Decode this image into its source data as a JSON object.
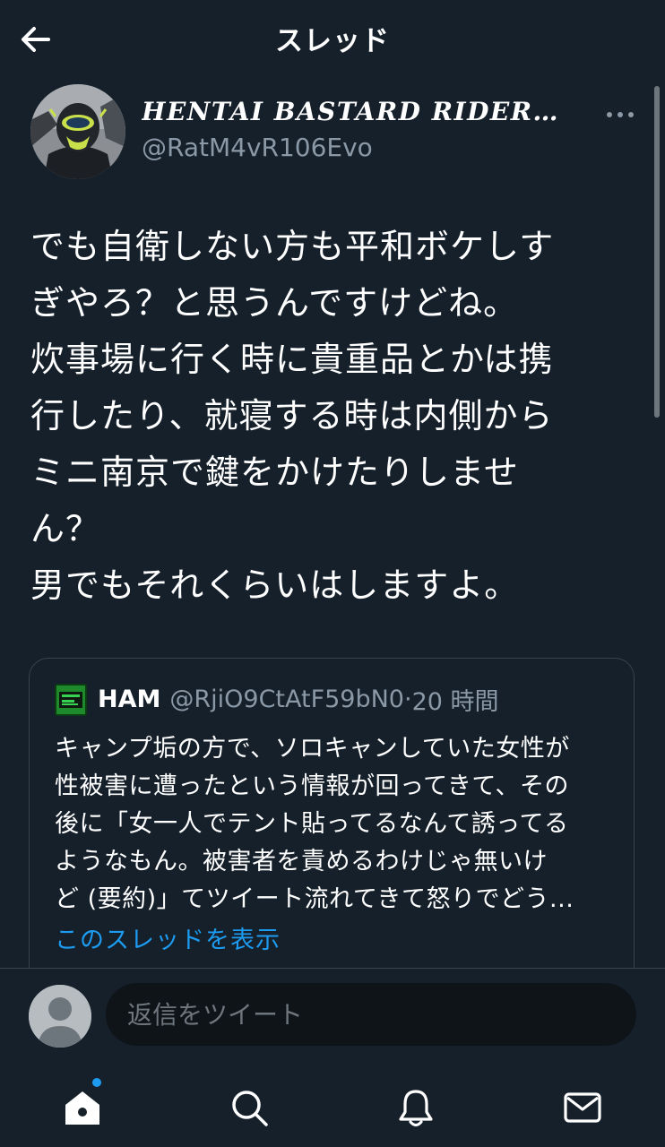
{
  "header": {
    "title": "スレッド"
  },
  "tweet": {
    "display_name": "HENTAI BASTARD RIDER©...",
    "handle": "@RatM4vR106Evo",
    "lines": [
      "でも自衛しない方も平和ボケしす",
      "ぎやろ？と思うんですけどね。",
      "炊事場に行く時に貴重品とかは携",
      "行したり、就寝する時は内側から",
      "ミニ南京で鍵をかけたりしませ",
      "ん？",
      "男でもそれくらいはしますよ。"
    ]
  },
  "quote": {
    "name": "HAM",
    "handle": "@RjiO9CtAtF59bN0",
    "separator": "·",
    "time": "20 時間",
    "lines": [
      "キャンプ垢の方で、ソロキャンしていた女性が",
      "性被害に遭ったという情報が回ってきて、その",
      "後に「女一人でテント貼ってるなんて誘ってる",
      "ようなもん。被害者を責めるわけじゃ無いけ",
      "ど (要約)」てツイート流れてきて怒りでどう..."
    ],
    "show_thread": "このスレッドを表示"
  },
  "reply": {
    "placeholder": "返信をツイート"
  },
  "colors": {
    "background": "#15202b",
    "text_primary": "#ffffff",
    "text_secondary": "#8b98a5",
    "accent": "#1d9bf0",
    "border": "#38444d"
  },
  "icons": {
    "back": "arrow-left-icon",
    "more": "more-horizontal-icon",
    "nav": [
      "home-icon",
      "search-icon",
      "bell-icon",
      "mail-icon"
    ]
  }
}
